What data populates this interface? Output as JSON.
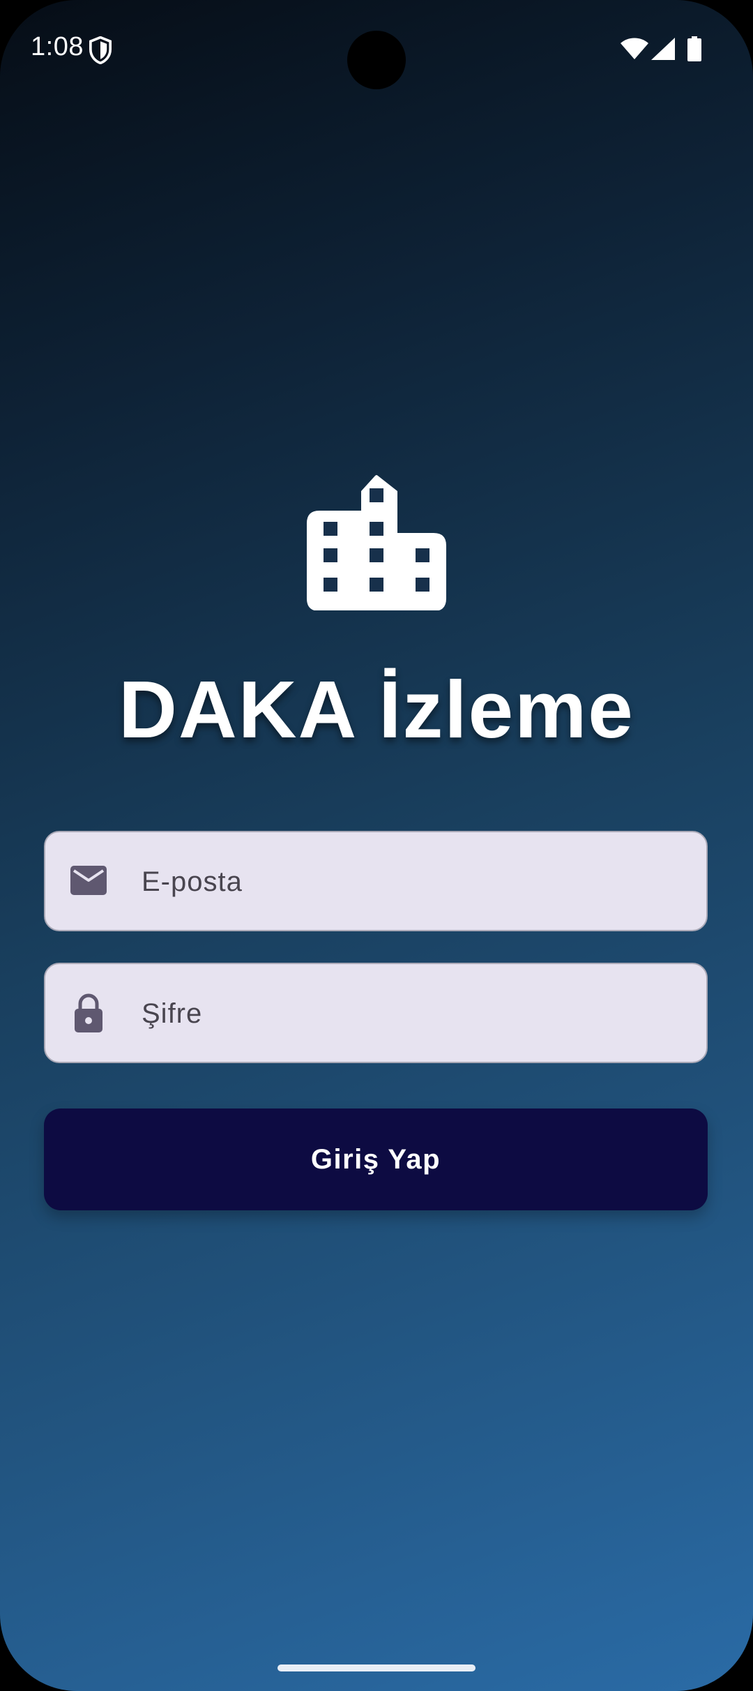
{
  "status_bar": {
    "time": "1:08",
    "icons": [
      "shield-icon",
      "wifi-icon",
      "signal-icon",
      "battery-icon"
    ]
  },
  "app": {
    "logo_icon": "building-icon",
    "title": "DAKA İzleme"
  },
  "login_form": {
    "email": {
      "icon": "mail-icon",
      "placeholder": "E-posta",
      "value": ""
    },
    "password": {
      "icon": "lock-icon",
      "placeholder": "Şifre",
      "value": ""
    },
    "submit_label": "Giriş Yap"
  },
  "colors": {
    "background_top": "#060d16",
    "background_bottom": "#2a6ba6",
    "field_background": "#e7e3f0",
    "field_icon": "#5f5870",
    "button_background": "#0d0b42",
    "text_light": "#ffffff"
  }
}
